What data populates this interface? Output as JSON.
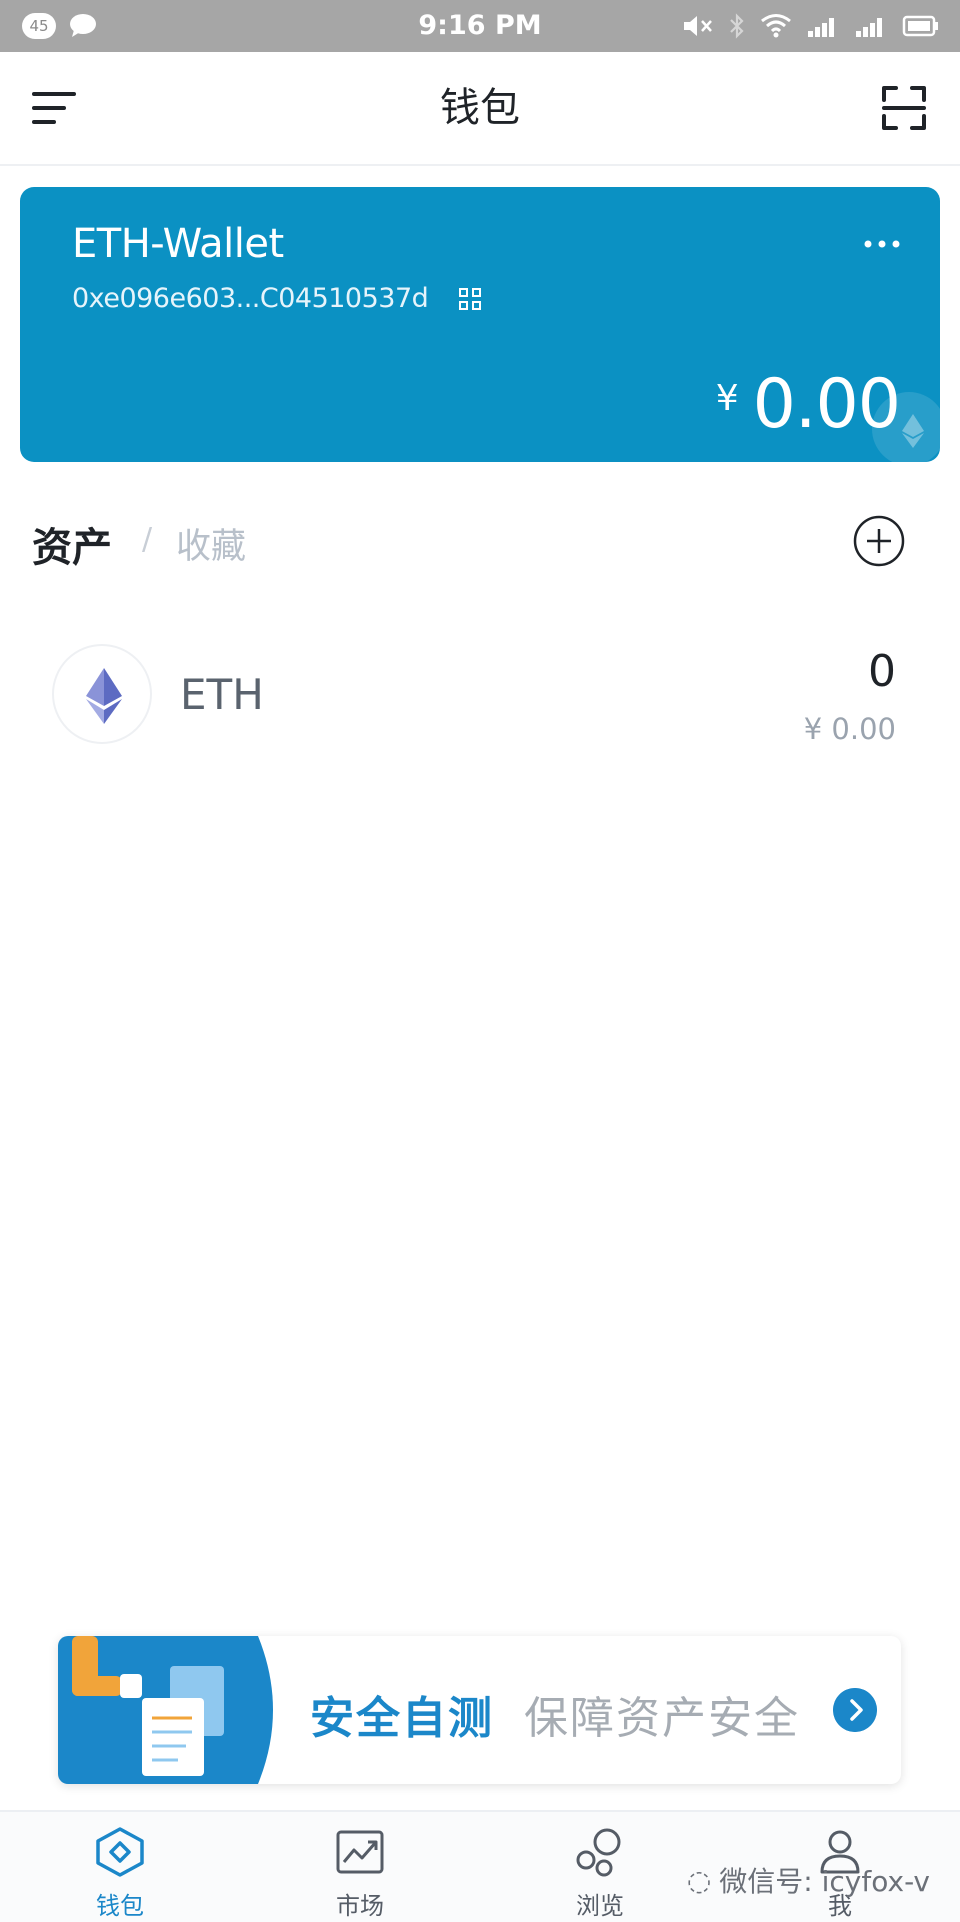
{
  "status_bar": {
    "notification_count": "45",
    "time": "9:16 PM",
    "icons": [
      "chat-icon",
      "mute-icon",
      "bluetooth-icon",
      "wifi-icon",
      "signal-icon",
      "signal-2-icon",
      "battery-icon"
    ]
  },
  "header": {
    "title": "钱包",
    "left_icon": "menu-icon",
    "right_icon": "scan-icon"
  },
  "wallet_card": {
    "name": "ETH-Wallet",
    "address": "0xe096e603...C04510537d",
    "currency_symbol": "¥",
    "balance": "0.00",
    "color": "#0b91c3"
  },
  "asset_tabs": {
    "active": "资产",
    "separator": "/",
    "inactive": "收藏"
  },
  "assets": [
    {
      "symbol": "ETH",
      "amount": "0",
      "value": "¥ 0.00"
    }
  ],
  "banner": {
    "title": "安全自测",
    "subtitle": "保障资产安全"
  },
  "bottom_nav": [
    {
      "label": "钱包",
      "icon": "wallet-icon",
      "active": true
    },
    {
      "label": "市场",
      "icon": "market-chart-icon",
      "active": false
    },
    {
      "label": "浏览",
      "icon": "browse-bubbles-icon",
      "active": false
    },
    {
      "label": "我",
      "icon": "user-icon",
      "active": false
    }
  ],
  "watermark": "微信号: icyfox-v",
  "accent_color": "#1b87c9"
}
